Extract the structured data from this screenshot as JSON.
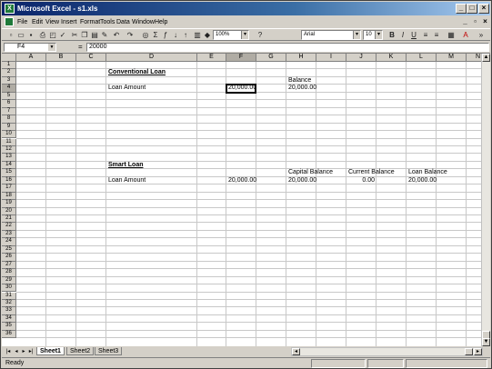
{
  "window": {
    "title": "Microsoft Excel - s1.xls"
  },
  "title_buttons": [
    "_",
    "□",
    "×"
  ],
  "menu": [
    "File",
    "Edit",
    "View",
    "Insert",
    "Format",
    "Tools",
    "Data",
    "Window",
    "Help"
  ],
  "doc_buttons": [
    "_",
    "▫",
    "×"
  ],
  "toolbar": {
    "zoom": "100%",
    "font": "Arial",
    "size": "10",
    "bold": "B",
    "italic": "I",
    "underline": "U"
  },
  "formula_bar": {
    "name_box": "F4",
    "eq": "=",
    "formula": "20000"
  },
  "columns": [
    "A",
    "B",
    "C",
    "D",
    "E",
    "F",
    "G",
    "H",
    "I",
    "J",
    "K",
    "L",
    "M",
    "N"
  ],
  "rows": [
    "1",
    "2",
    "3",
    "4",
    "5",
    "6",
    "7",
    "8",
    "9",
    "10",
    "11",
    "12",
    "13",
    "14",
    "15",
    "16",
    "17",
    "18",
    "19",
    "20",
    "21",
    "22",
    "23",
    "24",
    "25",
    "26",
    "27",
    "28",
    "29",
    "30",
    "31",
    "32",
    "33",
    "34",
    "35",
    "36"
  ],
  "active_cell": "F4",
  "cells": {
    "d2": "Conventional Loan",
    "h3": "Balance",
    "d4": "Loan Amount",
    "f4": "20,000.00",
    "h4": "20,000.00",
    "d14": "Smart Loan",
    "h15": "Capital Balance",
    "j15": "Current Balance",
    "l15": "Loan Balance",
    "d16": "Loan Amount",
    "f16": "20,000.00",
    "h16": "20,000.00",
    "j16": "0.00",
    "l16": "20,000.00"
  },
  "sheets": [
    "Sheet1",
    "Sheet2",
    "Sheet3"
  ],
  "active_sheet": "Sheet1",
  "status": "Ready"
}
